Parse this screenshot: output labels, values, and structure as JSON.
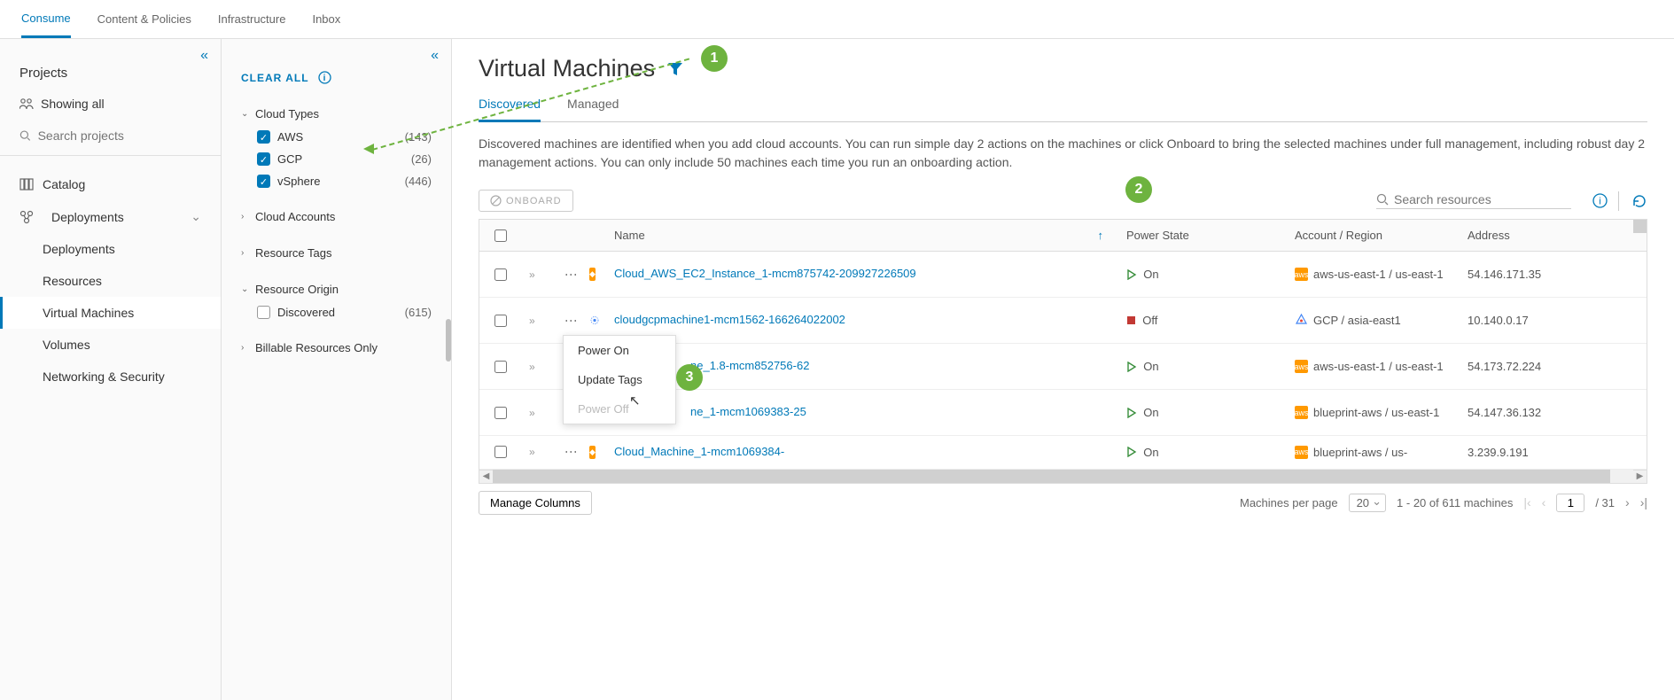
{
  "topTabs": {
    "t0": "Consume",
    "t1": "Content & Policies",
    "t2": "Infrastructure",
    "t3": "Inbox"
  },
  "sidebar1": {
    "projects": "Projects",
    "showingAll": "Showing all",
    "searchPlaceholder": "Search projects",
    "catalog": "Catalog",
    "deployments": "Deployments",
    "subDeployments": "Deployments",
    "subResources": "Resources",
    "subVM": "Virtual Machines",
    "subVolumes": "Volumes",
    "subNetSec": "Networking & Security"
  },
  "sidebar2": {
    "clearAll": "CLEAR ALL",
    "cloudTypes": "Cloud Types",
    "aws": "AWS",
    "awsCount": "(143)",
    "gcp": "GCP",
    "gcpCount": "(26)",
    "vsphere": "vSphere",
    "vsphereCount": "(446)",
    "cloudAccounts": "Cloud Accounts",
    "resourceTags": "Resource Tags",
    "resourceOrigin": "Resource Origin",
    "discovered": "Discovered",
    "discoveredCount": "(615)",
    "billable": "Billable Resources Only"
  },
  "main": {
    "title": "Virtual Machines",
    "tabDiscovered": "Discovered",
    "tabManaged": "Managed",
    "desc": "Discovered machines are identified when you add cloud accounts. You can run simple day 2 actions on the machines or click Onboard to bring the selected machines under full management, including robust day 2 management actions. You can only include 50 machines each time you run an onboarding action.",
    "onboard": "ONBOARD",
    "searchPlaceholder": "Search resources"
  },
  "cols": {
    "name": "Name",
    "power": "Power State",
    "acct": "Account / Region",
    "addr": "Address"
  },
  "rows": {
    "r0": {
      "name": "Cloud_AWS_EC2_Instance_1-mcm875742-209927226509",
      "power": "On",
      "acct": "aws-us-east-1 / us-east-1",
      "addr": "54.146.171.35"
    },
    "r1": {
      "name": "cloudgcpmachine1-mcm1562-166264022002",
      "power": "Off",
      "acct": "GCP / asia-east1",
      "addr": "10.140.0.17"
    },
    "r2": {
      "name": "ne_1.8-mcm852756-62",
      "power": "On",
      "acct": "aws-us-east-1 / us-east-1",
      "addr": "54.173.72.224"
    },
    "r3": {
      "name": "ne_1-mcm1069383-25",
      "power": "On",
      "acct": "blueprint-aws / us-east-1",
      "addr": "54.147.36.132"
    },
    "r4": {
      "name": "Cloud_Machine_1-mcm1069384-",
      "power": "On",
      "acct": "blueprint-aws / us-",
      "addr": "3.239.9.191"
    }
  },
  "menu": {
    "powerOn": "Power On",
    "updateTags": "Update Tags",
    "powerOff": "Power Off"
  },
  "footer": {
    "manageCols": "Manage Columns",
    "perPageLabel": "Machines per page",
    "perPage": "20",
    "range": "1 - 20 of 611 machines",
    "page": "1",
    "ofPages": "/ 31"
  },
  "callouts": {
    "c1": "1",
    "c2": "2",
    "c3": "3"
  }
}
